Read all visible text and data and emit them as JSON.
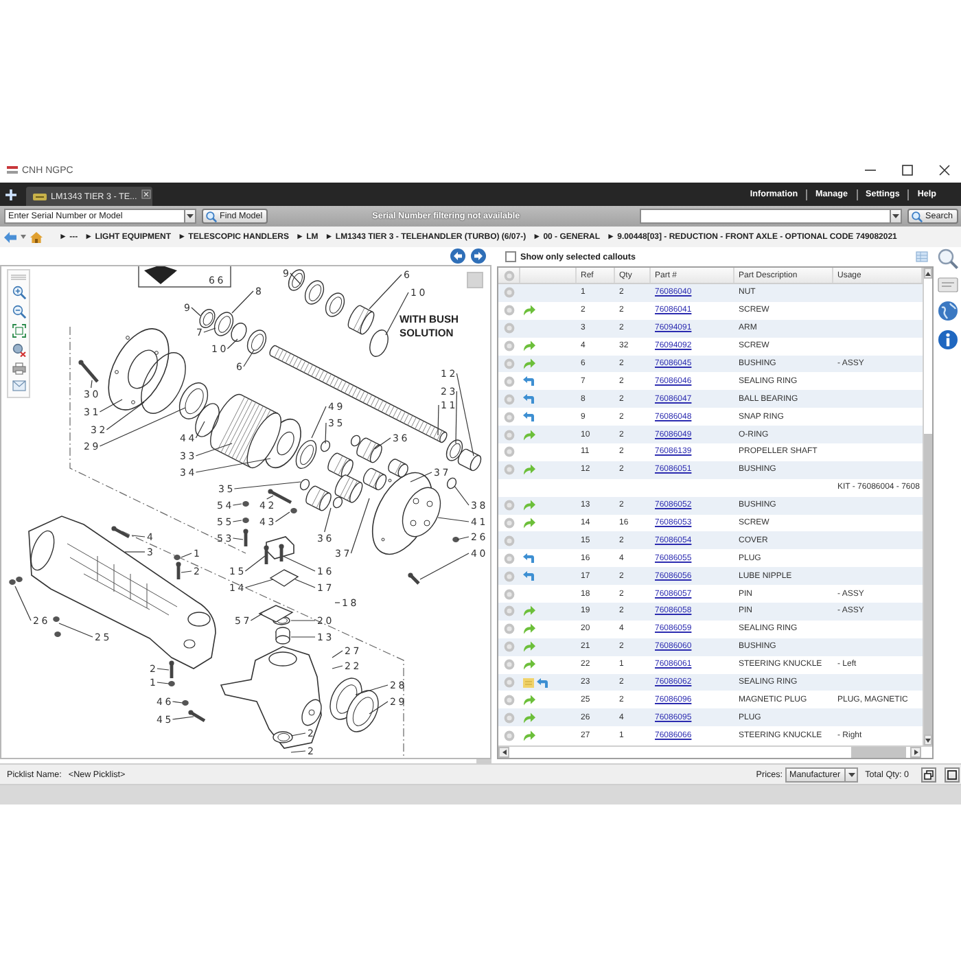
{
  "window": {
    "title": "CNH NGPC"
  },
  "tabs": [
    {
      "label": "LM1343 TIER 3 - TE...",
      "selected": true
    }
  ],
  "top_menu": [
    "Information",
    "Manage",
    "Settings",
    "Help"
  ],
  "toolbar": {
    "serial_field": {
      "placeholder": "Enter Serial Number or Model"
    },
    "find_button": "Find Model",
    "notice": "Serial Number filtering not available",
    "search_button": "Search"
  },
  "breadcrumb": [
    "► ---",
    "► LIGHT EQUIPMENT",
    "► TELESCOPIC HANDLERS",
    "► LM",
    "► LM1343 TIER 3 - TELEHANDLER (TURBO) (6/07-)",
    "► 00 - GENERAL",
    "► 9.00448[03] - REDUCTION - FRONT AXLE - OPTIONAL CODE 749082021"
  ],
  "diagram": {
    "note_lines": [
      "WITH BUSH",
      "SOLUTION"
    ],
    "callouts": [
      "66",
      "9",
      "6",
      "8",
      "10",
      "9",
      "7",
      "10",
      "6",
      "12",
      "30",
      "23",
      "31",
      "11",
      "49",
      "35",
      "32",
      "36",
      "44",
      "29",
      "33",
      "34",
      "37",
      "35",
      "54",
      "42",
      "38",
      "55",
      "43",
      "41",
      "4",
      "53",
      "36",
      "26",
      "3",
      "1",
      "37",
      "40",
      "2",
      "15",
      "16",
      "14",
      "17",
      "18",
      "26",
      "57",
      "20",
      "25",
      "13",
      "27",
      "22",
      "2",
      "1",
      "28",
      "46",
      "29",
      "45",
      "2",
      "2"
    ]
  },
  "parts_panel": {
    "filter": {
      "label": "Show only selected callouts",
      "checked": false
    },
    "columns": [
      "Ref",
      "Qty",
      "Part #",
      "Part Description",
      "Usage"
    ],
    "rows": [
      {
        "kind": "part",
        "ref": "1",
        "qty": "2",
        "part": "76086040",
        "description": "NUT"
      },
      {
        "kind": "part",
        "ref": "2",
        "qty": "2",
        "part": "76086041",
        "description": "SCREW",
        "icons": [
          {
            "kind": "curved"
          }
        ]
      },
      {
        "kind": "part",
        "ref": "3",
        "qty": "2",
        "part": "76094091",
        "description": "ARM"
      },
      {
        "kind": "part",
        "ref": "4",
        "qty": "32",
        "part": "76094092",
        "description": "SCREW",
        "icons": [
          {
            "kind": "curved"
          }
        ]
      },
      {
        "kind": "part",
        "ref": "6",
        "qty": "2",
        "part": "76086045",
        "description": "BUSHING",
        "usage": "- ASSY",
        "icons": [
          {
            "kind": "curved"
          }
        ]
      },
      {
        "kind": "part",
        "ref": "7",
        "qty": "2",
        "part": "76086046",
        "description": "SEALING RING",
        "icons": [
          {
            "kind": "hooked"
          }
        ]
      },
      {
        "kind": "part",
        "ref": "8",
        "qty": "2",
        "part": "76086047",
        "description": "BALL BEARING",
        "icons": [
          {
            "kind": "hooked"
          }
        ]
      },
      {
        "kind": "part",
        "ref": "9",
        "qty": "2",
        "part": "76086048",
        "description": "SNAP RING",
        "icons": [
          {
            "kind": "hooked"
          }
        ]
      },
      {
        "kind": "part",
        "ref": "10",
        "qty": "2",
        "part": "76086049",
        "description": "O-RING",
        "icons": [
          {
            "kind": "curved"
          }
        ]
      },
      {
        "kind": "part",
        "ref": "11",
        "qty": "2",
        "part": "76086139",
        "description": "PROPELLER SHAFT"
      },
      {
        "kind": "part",
        "ref": "12",
        "qty": "2",
        "part": "76086051",
        "description": "BUSHING",
        "icons": [
          {
            "kind": "curved"
          }
        ]
      },
      {
        "kind": "note",
        "usage": "KIT - 76086004 - 7608"
      },
      {
        "kind": "part",
        "ref": "13",
        "qty": "2",
        "part": "76086052",
        "description": "BUSHING",
        "icons": [
          {
            "kind": "curved"
          }
        ]
      },
      {
        "kind": "part",
        "ref": "14",
        "qty": "16",
        "part": "76086053",
        "description": "SCREW",
        "icons": [
          {
            "kind": "curved"
          }
        ]
      },
      {
        "kind": "part",
        "ref": "15",
        "qty": "2",
        "part": "76086054",
        "description": "COVER"
      },
      {
        "kind": "part",
        "ref": "16",
        "qty": "4",
        "part": "76086055",
        "description": "PLUG",
        "icons": [
          {
            "kind": "hooked"
          }
        ]
      },
      {
        "kind": "part",
        "ref": "17",
        "qty": "2",
        "part": "76086056",
        "description": "LUBE NIPPLE",
        "icons": [
          {
            "kind": "hooked"
          }
        ]
      },
      {
        "kind": "part",
        "ref": "18",
        "qty": "2",
        "part": "76086057",
        "description": "PIN",
        "usage": "- ASSY"
      },
      {
        "kind": "part",
        "ref": "19",
        "qty": "2",
        "part": "76086058",
        "description": "PIN",
        "usage": "- ASSY",
        "icons": [
          {
            "kind": "curved"
          }
        ]
      },
      {
        "kind": "part",
        "ref": "20",
        "qty": "4",
        "part": "76086059",
        "description": "SEALING RING",
        "icons": [
          {
            "kind": "curved"
          }
        ]
      },
      {
        "kind": "part",
        "ref": "21",
        "qty": "2",
        "part": "76086060",
        "description": "BUSHING",
        "icons": [
          {
            "kind": "curved"
          }
        ]
      },
      {
        "kind": "part",
        "ref": "22",
        "qty": "1",
        "part": "76086061",
        "description": "STEERING KNUCKLE",
        "usage": "- Left",
        "icons": [
          {
            "kind": "curved"
          }
        ]
      },
      {
        "kind": "part",
        "ref": "23",
        "qty": "2",
        "part": "76086062",
        "description": "SEALING RING",
        "icons": [
          {
            "kind": "folder"
          },
          {
            "kind": "hooked"
          }
        ]
      },
      {
        "kind": "part",
        "ref": "25",
        "qty": "2",
        "part": "76086096",
        "description": "MAGNETIC PLUG",
        "usage": "PLUG, MAGNETIC",
        "icons": [
          {
            "kind": "curved"
          }
        ]
      },
      {
        "kind": "part",
        "ref": "26",
        "qty": "4",
        "part": "76086095",
        "description": "PLUG",
        "icons": [
          {
            "kind": "curved"
          }
        ]
      },
      {
        "kind": "part",
        "ref": "27",
        "qty": "1",
        "part": "76086066",
        "description": "STEERING KNUCKLE",
        "usage": "- Right",
        "icons": [
          {
            "kind": "curved"
          }
        ]
      }
    ]
  },
  "picklist": {
    "label": "Picklist Name:",
    "value": "<New Picklist>"
  },
  "prices": {
    "label": "Prices:",
    "value": "Manufacturer"
  },
  "total_qty": "Total Qty: 0"
}
